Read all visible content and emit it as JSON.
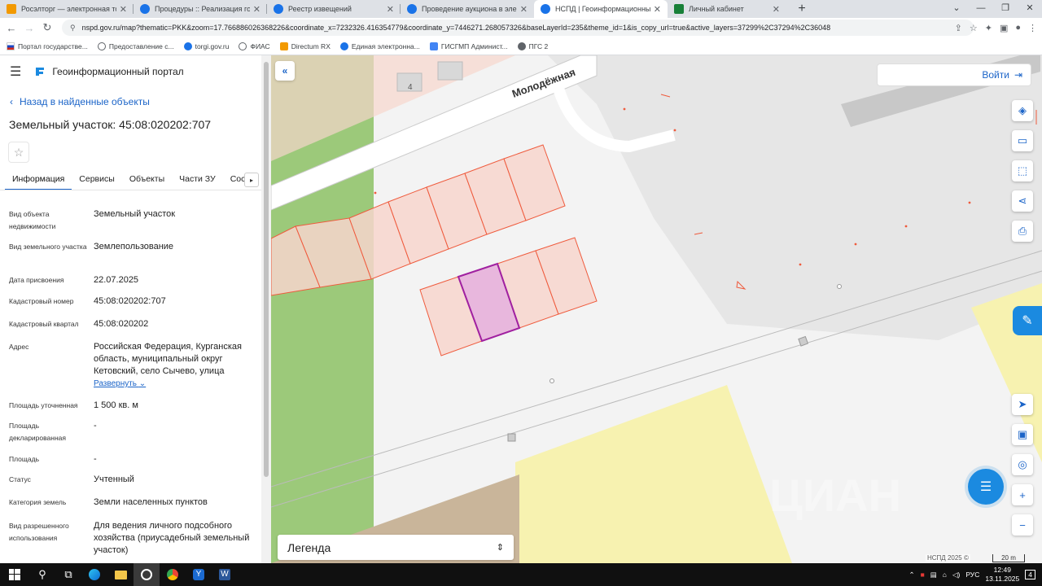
{
  "browser": {
    "tabs": [
      {
        "label": "Росэлторг — электронная торг",
        "color": "#f29900"
      },
      {
        "label": "Процедуры :: Реализация госи",
        "color": "#1a73e8"
      },
      {
        "label": "Реестр извещений",
        "color": "#1a73e8"
      },
      {
        "label": "Проведение аукциона в электр",
        "color": "#1a73e8"
      },
      {
        "label": "НСПД | Геоинформационный п",
        "color": "#1a73e8"
      },
      {
        "label": "Личный кабинет",
        "color": "#188038"
      }
    ],
    "active_tab": 4,
    "url": "nspd.gov.ru/map?thematic=PKK&zoom=17.766886026368226&coordinate_x=7232326.416354779&coordinate_y=7446271.268057326&baseLayerId=235&theme_id=1&is_copy_url=true&active_layers=37299%2C37294%2C36048",
    "bookmarks": [
      {
        "label": "Портал государстве..."
      },
      {
        "label": "Предоставление с..."
      },
      {
        "label": "torgi.gov.ru"
      },
      {
        "label": "ФИАС"
      },
      {
        "label": "Directum RX"
      },
      {
        "label": "Единая электронна..."
      },
      {
        "label": "ГИСГМП Админист..."
      },
      {
        "label": "ПГС 2"
      }
    ]
  },
  "panel": {
    "portal_title": "Геоинформационный портал",
    "back_link": "Назад в найденные объекты",
    "title": "Земельный участок: 45:08:020202:707",
    "tabs": [
      "Информация",
      "Сервисы",
      "Объекты",
      "Части ЗУ",
      "Соста"
    ],
    "attributes": [
      {
        "key": "Вид объекта недвижимости",
        "value": "Земельный участок"
      },
      {
        "key": "Вид земельного участка",
        "value": "Землепользование"
      },
      {
        "key": "Дата присвоения",
        "value": "22.07.2025"
      },
      {
        "key": "Кадастровый номер",
        "value": "45:08:020202:707"
      },
      {
        "key": "Кадастровый квартал",
        "value": "45:08:020202"
      },
      {
        "key": "Адрес",
        "value": "Российская Федерация, Курганская область, муниципальный округ Кетовский, село Сычево, улица",
        "expand": "Развернуть"
      },
      {
        "key": "Площадь уточненная",
        "value": "1 500 кв. м"
      },
      {
        "key": "Площадь декларированная",
        "value": "-"
      },
      {
        "key": "Площадь",
        "value": "-"
      },
      {
        "key": "Статус",
        "value": "Учтенный"
      },
      {
        "key": "Категория земель",
        "value": "Земли населенных пунктов"
      },
      {
        "key": "Вид разрешенного использования",
        "value": "Для ведения личного подсобного хозяйства (приусадебный земельный участок)"
      }
    ]
  },
  "map": {
    "login_label": "Войти",
    "street_label": "Молодёжная",
    "house_number": "4",
    "legend_label": "Легенда",
    "credit": "НСПД 2025 ©",
    "scale_label": "20 m",
    "watermark": "ЦИАН"
  },
  "taskbar": {
    "lang": "РУС",
    "time": "12:49",
    "date": "13.11.2025",
    "notifications": "4"
  }
}
